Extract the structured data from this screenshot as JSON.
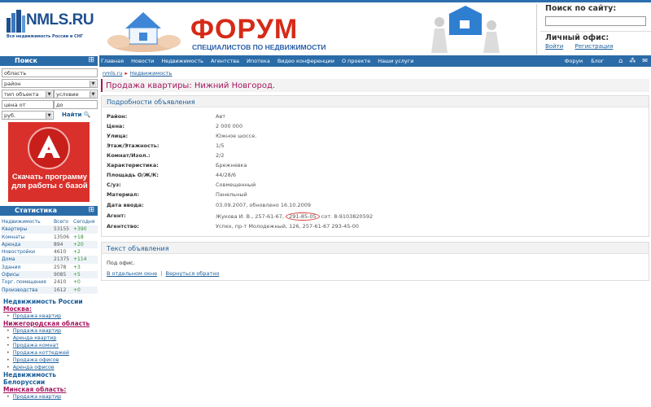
{
  "logo": {
    "name": "NMLS.RU",
    "tagline": "Вся недвижимость России и СНГ"
  },
  "banner": {
    "title": "ФОРУМ",
    "subtitle": "СПЕЦИАЛИСТОВ ПО НЕДВИЖИМОСТИ"
  },
  "site_search": {
    "title": "Поиск по сайту:"
  },
  "office": {
    "title": "Личный офис:",
    "login": "Войти",
    "register": "Регистрация"
  },
  "nav": {
    "items": [
      "Главная",
      "Новости",
      "Недвижимость",
      "Агентства",
      "Ипотека",
      "Видео конференции",
      "О проекте",
      "Наши услуги"
    ],
    "right": [
      "Форум",
      "Блог"
    ]
  },
  "search": {
    "title": "Поиск",
    "region": "область",
    "district": "район",
    "object_type": "тип объекта",
    "condition": "условие",
    "price_from": "цена от",
    "price_to": "до",
    "currency": "руб.",
    "find": "Найти"
  },
  "ad": {
    "text": "Скачать программу для работы с базой"
  },
  "stats": {
    "title": "Статистика",
    "headers": [
      "Недвижимость",
      "Всего",
      "Сегодня"
    ],
    "rows": [
      [
        "Квартиры",
        "53155",
        "+390"
      ],
      [
        "Комнаты",
        "13506",
        "+18"
      ],
      [
        "Аренда",
        "894",
        "+20"
      ],
      [
        "Новостройки",
        "4610",
        "+2"
      ],
      [
        "Дома",
        "21375",
        "+114"
      ],
      [
        "Здания",
        "2578",
        "+3"
      ],
      [
        "Офисы",
        "9085",
        "+5"
      ],
      [
        "Торг. помещения",
        "2410",
        "+0"
      ],
      [
        "Производства",
        "1612",
        "+0"
      ]
    ]
  },
  "regions": {
    "russia": "Недвижимость России",
    "moscow": "Москва:",
    "moscow_items": [
      "Продажа квартир"
    ],
    "nn_region": "Нижегородская область",
    "nn_items": [
      "Продажа квартир",
      "Аренда квартир",
      "Продажа комнат",
      "Продажа коттеджей",
      "Продажа офисов",
      "Аренда офисов"
    ],
    "belarus": "Недвижимость Белоруссии",
    "minsk": "Минская область:",
    "minsk_items": [
      "Продажа квартир"
    ]
  },
  "breadcrumb": {
    "home": "nmls.ru",
    "section": "Недвижимость"
  },
  "page_title": "Продажа квартиры: Нижний Новгород.",
  "details": {
    "title": "Подробности объявления",
    "rows": [
      {
        "label": "Район:",
        "value": "Авт"
      },
      {
        "label": "Цена:",
        "value": "2 000 000"
      },
      {
        "label": "Улица:",
        "value": "Южное шоссе."
      },
      {
        "label": "Этаж/Этажность:",
        "value": "1/5"
      },
      {
        "label": "Комнат/Изол.:",
        "value": "2/2"
      },
      {
        "label": "Характеристика:",
        "value": "Брежневка"
      },
      {
        "label": "Площадь О/Ж/К:",
        "value": "44/28/6"
      },
      {
        "label": "С/уз:",
        "value": "Совмещенный"
      },
      {
        "label": "Материал:",
        "value": "Панельный"
      },
      {
        "label": "Дата ввода:",
        "value": "03.09.2007, обновлено 16.10.2009"
      }
    ],
    "agent_label": "Агент:",
    "agent_prefix": "Жукова И. В., 257-61-67,",
    "agent_circled": "291-85-05",
    "agent_suffix": "сот. 8-9103820592",
    "agency_label": "Агентство:",
    "agency_value": "Успех, пр-т Молодежный, 126, 257-61-67 293-45-00"
  },
  "text_section": {
    "title": "Текст объявления",
    "body": "Под офис.",
    "open_new": "В отдельном окне",
    "separator": "|",
    "go_back": "Вернуться обратно"
  }
}
